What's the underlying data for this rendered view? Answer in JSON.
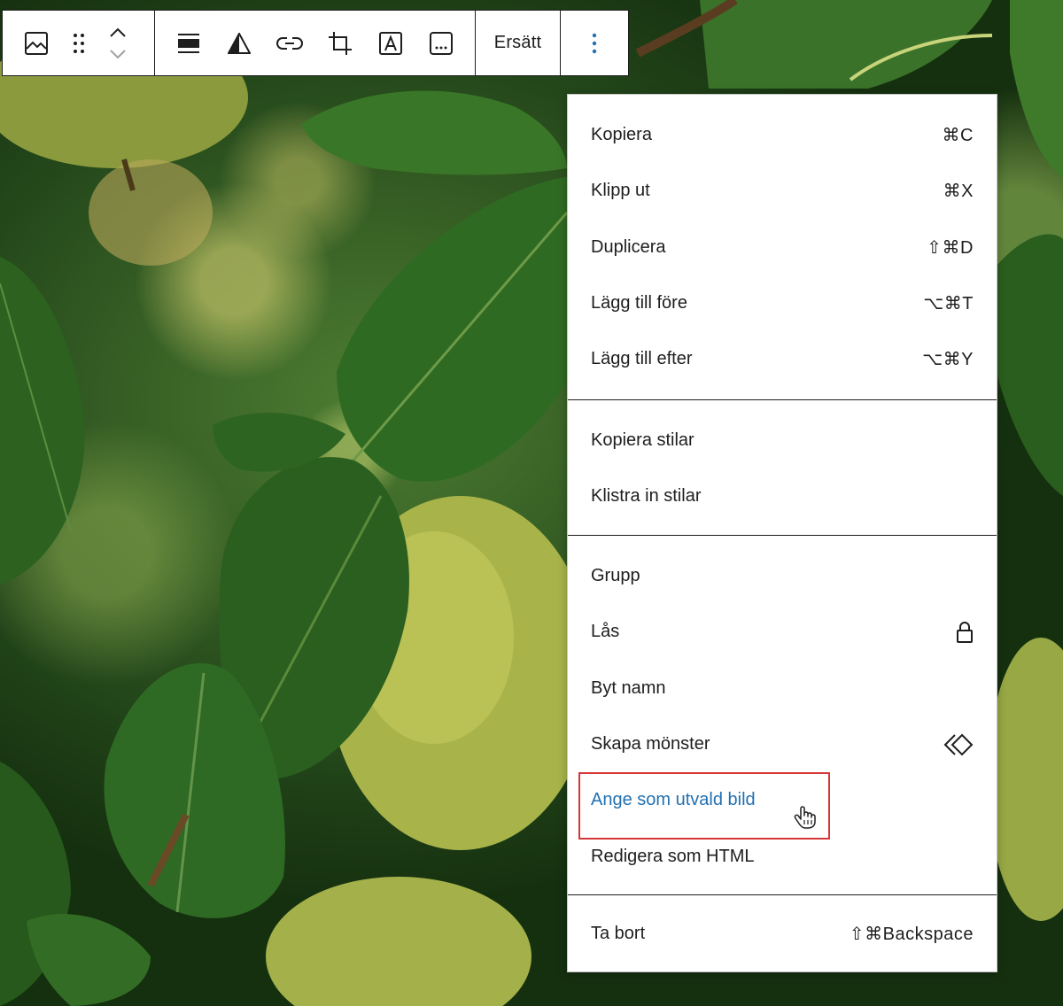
{
  "toolbar": {
    "groups": [
      {
        "items": [
          "image-icon",
          "drag-handle-icon",
          "move-up-icon",
          "move-down-icon"
        ]
      },
      {
        "items": [
          "align-icon",
          "duotone-icon",
          "link-icon",
          "crop-icon",
          "text-overlay-icon",
          "caption-icon"
        ]
      },
      {
        "items": [
          "replace"
        ]
      },
      {
        "items": [
          "more-options-icon"
        ]
      }
    ],
    "replace_label": "Ersätt"
  },
  "menu": {
    "groups": [
      {
        "items": [
          {
            "label": "Kopiera",
            "shortcut": "⌘C"
          },
          {
            "label": "Klipp ut",
            "shortcut": "⌘X"
          },
          {
            "label": "Duplicera",
            "shortcut": "⇧⌘D"
          },
          {
            "label": "Lägg till före",
            "shortcut": "⌥⌘T"
          },
          {
            "label": "Lägg till efter",
            "shortcut": "⌥⌘Y"
          }
        ]
      },
      {
        "items": [
          {
            "label": "Kopiera stilar"
          },
          {
            "label": "Klistra in stilar"
          }
        ]
      },
      {
        "items": [
          {
            "label": "Grupp"
          },
          {
            "label": "Lås",
            "icon": "lock-icon"
          },
          {
            "label": "Byt namn"
          },
          {
            "label": "Skapa mönster",
            "icon": "pattern-icon"
          },
          {
            "label": "Ange som utvald bild",
            "highlighted": true
          },
          {
            "label": "Redigera som HTML"
          }
        ]
      },
      {
        "items": [
          {
            "label": "Ta bort",
            "shortcut": "⇧⌘Backspace"
          }
        ]
      }
    ]
  },
  "colors": {
    "highlight_text": "#2271b1",
    "highlight_border": "#d63638",
    "toolbar_border": "#1e1e1e"
  }
}
